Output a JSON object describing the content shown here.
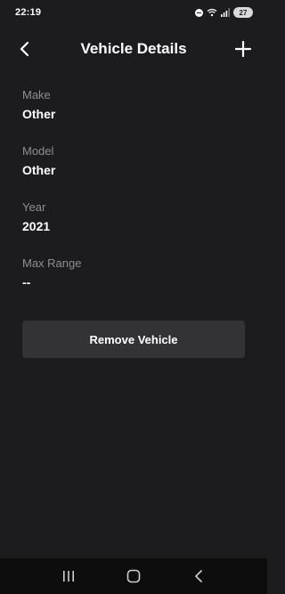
{
  "status_bar": {
    "time": "22:19",
    "battery": "27",
    "icons": [
      "dnd-icon",
      "wifi-icon",
      "signal-icon",
      "battery-icon"
    ]
  },
  "header": {
    "title": "Vehicle Details",
    "back_icon": "chevron-left-icon",
    "add_icon": "plus-icon"
  },
  "details": [
    {
      "label": "Make",
      "value": "Other"
    },
    {
      "label": "Model",
      "value": "Other"
    },
    {
      "label": "Year",
      "value": "2021"
    },
    {
      "label": "Max Range",
      "value": "--"
    }
  ],
  "actions": {
    "remove_label": "Remove Vehicle"
  },
  "nav_bar": {
    "icons": [
      "recent-apps-icon",
      "home-icon",
      "back-icon"
    ]
  },
  "colors": {
    "background": "#1c1c1e",
    "label": "#8e8e93",
    "button": "#333335",
    "nav_bar": "#0d0d0d"
  }
}
